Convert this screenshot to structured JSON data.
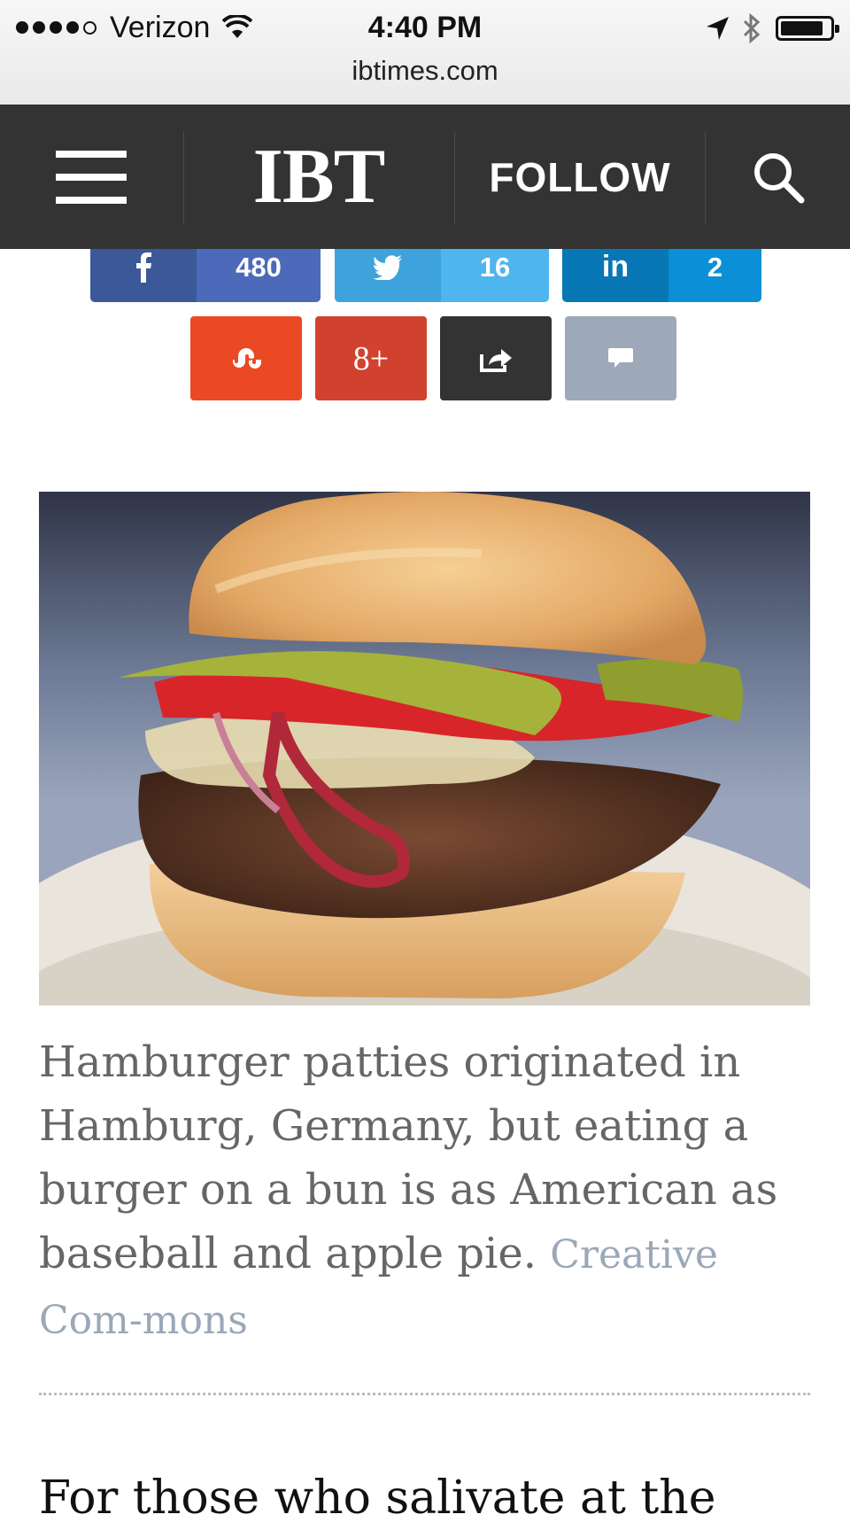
{
  "status_bar": {
    "carrier": "Verizon",
    "time": "4:40 PM",
    "url": "ibtimes.com"
  },
  "navbar": {
    "logo": "IBT",
    "follow_label": "FOLLOW",
    "background": "#333333"
  },
  "share": {
    "facebook": {
      "count": "480",
      "color": "#3b5998",
      "count_color": "#4c69ba"
    },
    "twitter": {
      "count": "16",
      "color": "#3ea3dc",
      "count_color": "#4fb5ee"
    },
    "linkedin": {
      "count": "2",
      "color": "#0877b5",
      "count_color": "#0b8fd6"
    },
    "stumbleupon": {
      "color": "#eb4924"
    },
    "googleplus": {
      "label": "8+",
      "color": "#d0422e"
    },
    "share": {
      "color": "#333333"
    },
    "comment": {
      "color": "#9da8b8"
    }
  },
  "article": {
    "image_name": "hamburger-photo",
    "caption": "Hamburger patties originated in Hamburg, Germany, but eating a burger on a bun is as American as baseball and apple pie.",
    "credit": "Creative Com-mons",
    "body_start": "For those who salivate at the"
  }
}
